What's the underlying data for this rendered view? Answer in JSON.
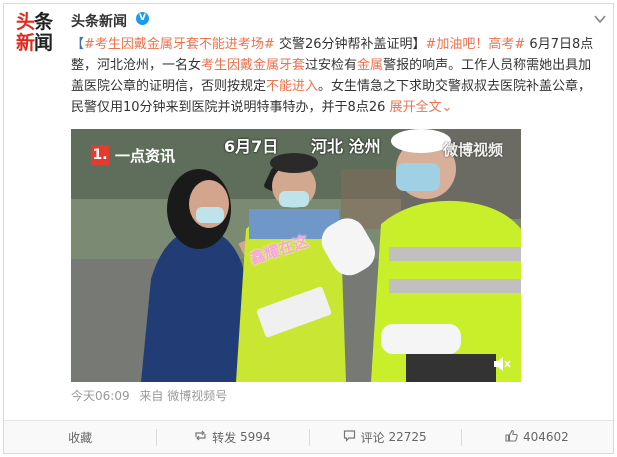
{
  "logo": {
    "line1_red": "头",
    "line1_black": "条",
    "line2_red": "新",
    "line2_black": "闻"
  },
  "author": {
    "name": "头条新闻",
    "badge": "V"
  },
  "post": {
    "bracket_open": "【",
    "tag1": "#考生因戴金属牙套不能进考场#",
    "text1": " 交警26分钟帮补盖证明】",
    "tag2": "#加油吧！高考#",
    "text2": " 6月7日8点整，河北沧州，一名女",
    "hl1": "考生因戴金属牙套",
    "text3": "过安检有",
    "hl2": "金属",
    "text4": "警报的响声。工作人员称需她出具加盖医院公章的证明信，否则按规定",
    "hl3": "不能进入",
    "text5": "。女生情急之下求助交警叔叔去医院补盖公章，民警仅用10分钟来到医院并说明特事特办，并于8点26 ",
    "more": "展开全文",
    "more_arrow": "⌄"
  },
  "video": {
    "source_num": "1.",
    "source_name": "一点资讯",
    "date": "6月7日",
    "place": "河北 沧州",
    "watermark": "微博视频",
    "sticker": "鑫耀在这"
  },
  "meta": {
    "time": "今天06:09",
    "from_label": "来自",
    "from": "微博视频号"
  },
  "actions": {
    "collect": "收藏",
    "repost_label": "转发",
    "repost_count": "5994",
    "comment_label": "评论",
    "comment_count": "22725",
    "like_count": "404602"
  },
  "colors": {
    "accent": "#eb7350",
    "brand_red": "#e0291f",
    "verify_blue": "#1b9bf0",
    "vest": "#c8e632"
  }
}
